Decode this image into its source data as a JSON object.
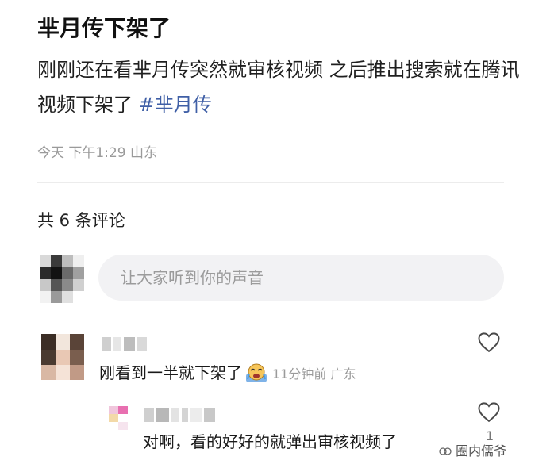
{
  "post": {
    "title": "芈月传下架了",
    "body": "刚刚还在看芈月传突然就审核视频 之后推出搜索就在腾讯视频下架了 ",
    "hashtag": "#芈月传",
    "meta": "今天 下午1:29 山东"
  },
  "comments_header": {
    "count_label": "共 6 条评论"
  },
  "comment_input": {
    "placeholder": "让大家听到你的声音"
  },
  "comments": [
    {
      "text": "刚看到一半就下架了",
      "emoji_icon": "crying-face-icon",
      "meta": "11分钟前 广东"
    }
  ],
  "replies": [
    {
      "text": "对啊，看的好好的就弹出审核视频了",
      "like_count": "1"
    }
  ],
  "watermark": {
    "text": "圈内儒爷"
  },
  "colors": {
    "hashtag": "#3f5fa6",
    "meta": "#9a9a9a",
    "input_bg": "#f2f2f4"
  }
}
